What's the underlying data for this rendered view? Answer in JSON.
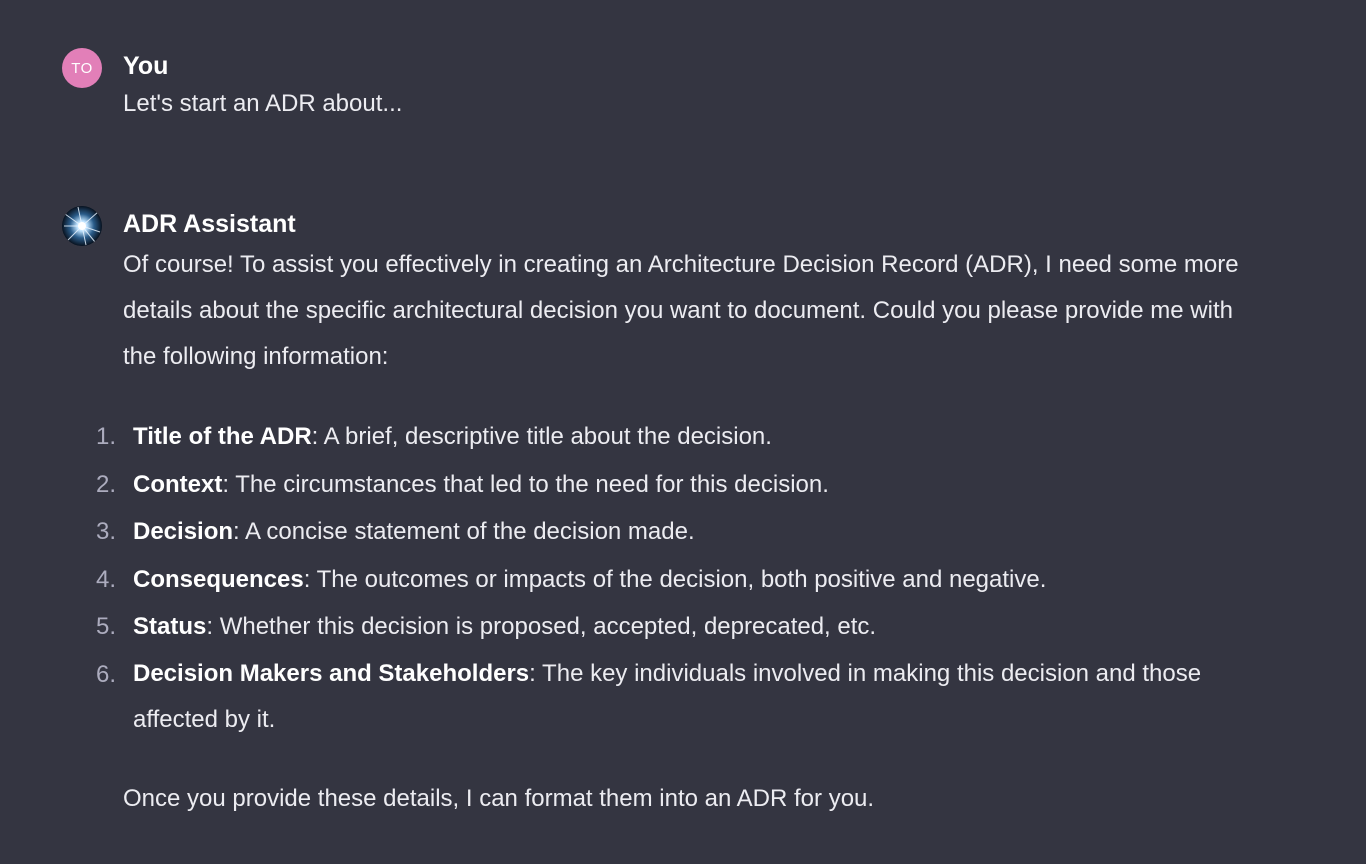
{
  "messages": [
    {
      "author": "You",
      "avatar_initials": "TO",
      "avatar_color": "#e27fb8",
      "text": "Let's start an ADR about..."
    },
    {
      "author": "ADR Assistant",
      "avatar_icon": "assistant-avatar-icon",
      "intro": "Of course! To assist you effectively in creating an Architecture Decision Record (ADR), I need some more details about the specific architectural decision you want to document. Could you please provide me with the following information:",
      "list": [
        {
          "num": "1.",
          "term": "Title of the ADR",
          "desc": ": A brief, descriptive title about the decision."
        },
        {
          "num": "2.",
          "term": "Context",
          "desc": ": The circumstances that led to the need for this decision."
        },
        {
          "num": "3.",
          "term": "Decision",
          "desc": ": A concise statement of the decision made."
        },
        {
          "num": "4.",
          "term": "Consequences",
          "desc": ": The outcomes or impacts of the decision, both positive and negative."
        },
        {
          "num": "5.",
          "term": "Status",
          "desc": ": Whether this decision is proposed, accepted, deprecated, etc."
        },
        {
          "num": "6.",
          "term": "Decision Makers and Stakeholders",
          "desc": ": The key individuals involved in making this decision and those affected by it."
        }
      ],
      "outro": "Once you provide these details, I can format them into an ADR for you."
    }
  ]
}
